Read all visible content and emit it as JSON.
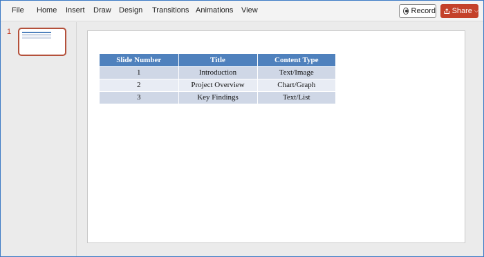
{
  "menu": {
    "items": [
      "File",
      "Home",
      "Insert",
      "Draw",
      "Design",
      "Transitions",
      "Animations",
      "View"
    ],
    "record_label": "Record",
    "share_label": "Share"
  },
  "thumbnails": [
    {
      "number": "1"
    }
  ],
  "slide": {
    "table": {
      "headers": [
        "Slide Number",
        "Title",
        "Content Type"
      ],
      "rows": [
        [
          "1",
          "Introduction",
          "Text/Image"
        ],
        [
          "2",
          "Project Overview",
          "Chart/Graph"
        ],
        [
          "3",
          "Key Findings",
          "Text/List"
        ]
      ]
    }
  },
  "colors": {
    "accent": "#c4412a",
    "table_header": "#4f81bd",
    "table_row_dark": "#cfd7e6",
    "table_row_light": "#e8ecf4"
  },
  "icons": [
    "record-icon",
    "share-icon",
    "chevron-down-icon"
  ]
}
